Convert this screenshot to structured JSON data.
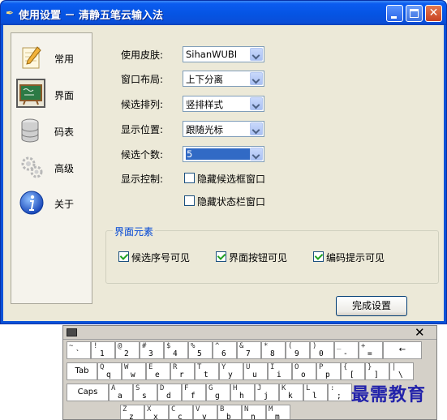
{
  "window": {
    "title": "使用设置 － 清静五笔云输入法"
  },
  "sidebar": {
    "items": [
      {
        "label": "常用",
        "icon": "pencil-paper-icon"
      },
      {
        "label": "界面",
        "icon": "blackboard-icon"
      },
      {
        "label": "码表",
        "icon": "database-icon"
      },
      {
        "label": "高级",
        "icon": "gears-icon"
      },
      {
        "label": "关于",
        "icon": "info-icon"
      }
    ],
    "selected": "界面"
  },
  "settings": {
    "skin": {
      "label": "使用皮肤:",
      "value": "SihanWUBI"
    },
    "layout": {
      "label": "窗口布局:",
      "value": "上下分离"
    },
    "arrange": {
      "label": "候选排列:",
      "value": "竖排样式"
    },
    "position": {
      "label": "显示位置:",
      "value": "跟随光标"
    },
    "count": {
      "label": "候选个数:",
      "value": "5"
    },
    "display_control": {
      "label": "显示控制:",
      "hide_candidate": {
        "label": "隐藏候选框窗口",
        "checked": false
      },
      "hide_status": {
        "label": "隐藏状态栏窗口",
        "checked": false
      }
    }
  },
  "elements_group": {
    "title": "界面元素",
    "options": [
      {
        "label": "候选序号可见",
        "checked": true
      },
      {
        "label": "界面按钮可见",
        "checked": true
      },
      {
        "label": "编码提示可见",
        "checked": true
      }
    ]
  },
  "buttons": {
    "finish": "完成设置"
  },
  "keyboard": {
    "close": "✕",
    "row1": [
      {
        "u": "~",
        "l": "`"
      },
      {
        "u": "!",
        "l": "1"
      },
      {
        "u": "@",
        "l": "2"
      },
      {
        "u": "#",
        "l": "3"
      },
      {
        "u": "$",
        "l": "4"
      },
      {
        "u": "%",
        "l": "5"
      },
      {
        "u": "^",
        "l": "6"
      },
      {
        "u": "&",
        "l": "7"
      },
      {
        "u": "*",
        "l": "8"
      },
      {
        "u": "(",
        "l": "9"
      },
      {
        "u": ")",
        "l": "0"
      },
      {
        "u": "_",
        "l": "-"
      },
      {
        "u": "+",
        "l": "="
      }
    ],
    "backspace": "←",
    "tab": "Tab",
    "row2": [
      {
        "u": "Q",
        "l": "q"
      },
      {
        "u": "W",
        "l": "w"
      },
      {
        "u": "E",
        "l": "e"
      },
      {
        "u": "R",
        "l": "r"
      },
      {
        "u": "T",
        "l": "t"
      },
      {
        "u": "Y",
        "l": "y"
      },
      {
        "u": "U",
        "l": "u"
      },
      {
        "u": "I",
        "l": "i"
      },
      {
        "u": "O",
        "l": "o"
      },
      {
        "u": "P",
        "l": "p"
      },
      {
        "u": "{",
        "l": "["
      },
      {
        "u": "}",
        "l": "]"
      },
      {
        "u": "|",
        "l": "\\"
      }
    ],
    "caps": "Caps",
    "row3": [
      {
        "u": "A",
        "l": "a"
      },
      {
        "u": "S",
        "l": "s"
      },
      {
        "u": "D",
        "l": "d"
      },
      {
        "u": "F",
        "l": "f"
      },
      {
        "u": "G",
        "l": "g"
      },
      {
        "u": "H",
        "l": "h"
      },
      {
        "u": "J",
        "l": "j"
      },
      {
        "u": "K",
        "l": "k"
      },
      {
        "u": "L",
        "l": "l"
      },
      {
        "u": ":",
        "l": ";"
      }
    ],
    "row4": [
      {
        "u": "Z",
        "l": "z"
      },
      {
        "u": "X",
        "l": "x"
      },
      {
        "u": "C",
        "l": "c"
      },
      {
        "u": "V",
        "l": "v"
      },
      {
        "u": "B",
        "l": "b"
      },
      {
        "u": "N",
        "l": "n"
      },
      {
        "u": "M",
        "l": "m"
      }
    ]
  },
  "watermark": "最需教育"
}
